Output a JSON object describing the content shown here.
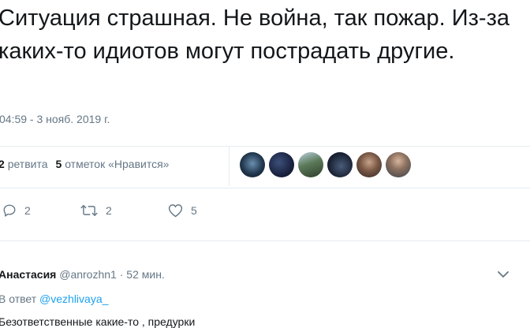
{
  "tweet": {
    "text": "Ситуация страшная. Не война, так пожар. Из-за каких-то идиотов могут пострадать другие.",
    "timestamp": "04:59 - 3 нояб. 2019 г."
  },
  "stats": {
    "retweets_count": "2",
    "retweets_label": "ретвита",
    "likes_count": "5",
    "likes_label": "отметок «Нравится»"
  },
  "actions": {
    "reply_count": "2",
    "retweet_count": "2",
    "like_count": "5"
  },
  "reply": {
    "author_name": "Анастасия",
    "author_handle": "@anrozhn1",
    "separator": "·",
    "time_ago": "52 мин.",
    "reply_to_label": "В ответ",
    "reply_to_handle": "@vezhlivaya_",
    "text": "Безответственные какие-то , предурки"
  },
  "icons": {
    "reply": "reply-icon",
    "retweet": "retweet-icon",
    "like": "heart-icon",
    "more": "chevron-down-icon"
  },
  "colors": {
    "text": "#14171a",
    "muted": "#657786",
    "link": "#1da1f2",
    "divider": "#e6ecf0"
  }
}
